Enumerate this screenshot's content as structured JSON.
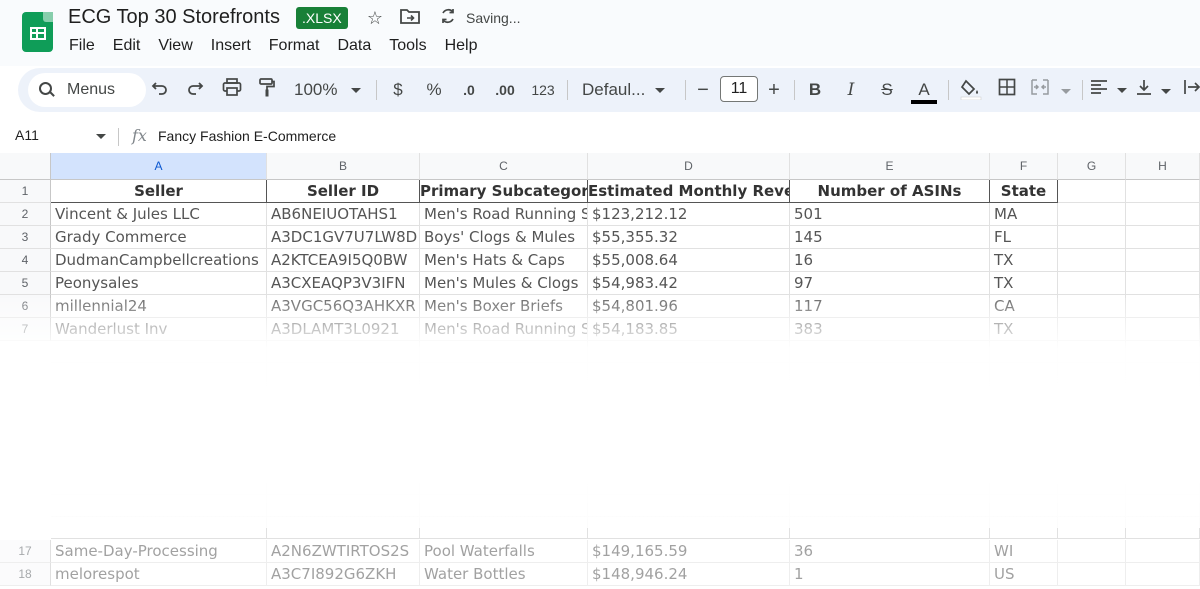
{
  "header": {
    "title": "ECG Top 30 Storefronts",
    "badge": ".XLSX",
    "status": "Saving...",
    "star_icon": "star-icon",
    "move_icon": "folder-move-icon",
    "sync_icon": "sync-icon"
  },
  "menubar": [
    "File",
    "Edit",
    "View",
    "Insert",
    "Format",
    "Data",
    "Tools",
    "Help"
  ],
  "toolbar": {
    "menus_label": "Menus",
    "zoom": "100%",
    "currency": "$",
    "percent": "%",
    "dec_decrease": ".0",
    "dec_increase": ".00",
    "number_format": "123",
    "font": "Defaul...",
    "font_size": "11",
    "minus": "−",
    "plus": "+",
    "bold": "B",
    "italic": "I",
    "strike": "S",
    "text_color": "A"
  },
  "formula": {
    "name_box": "A11",
    "fx": "fx",
    "value": "Fancy Fashion E-Commerce"
  },
  "columns": [
    "A",
    "B",
    "C",
    "D",
    "E",
    "F",
    "G",
    "H"
  ],
  "rows": [
    {
      "num": "1",
      "cells": [
        "Seller",
        "Seller ID",
        "Primary Subcategory",
        "Estimated Monthly Revenue",
        "Number of ASINs",
        "State"
      ]
    },
    {
      "num": "2",
      "cells": [
        "Vincent & Jules LLC",
        "AB6NEIUOTAHS1",
        "Men's Road Running Sho",
        "$123,212.12",
        "501",
        "MA"
      ]
    },
    {
      "num": "3",
      "cells": [
        "Grady Commerce",
        "A3DC1GV7U7LW8D",
        "Boys' Clogs & Mules",
        "$55,355.32",
        "145",
        "FL"
      ]
    },
    {
      "num": "4",
      "cells": [
        "DudmanCampbellcreations",
        "A2KTCEA9I5Q0BW",
        "Men's Hats & Caps",
        "$55,008.64",
        "16",
        "TX"
      ]
    },
    {
      "num": "5",
      "cells": [
        "Peonysales",
        "A3CXEAQP3V3IFN",
        "Men's Mules & Clogs",
        "$54,983.42",
        "97",
        "TX"
      ]
    },
    {
      "num": "6",
      "cells": [
        "millennial24",
        "A3VGC56Q3AHKXR",
        "Men's Boxer Briefs",
        "$54,801.96",
        "117",
        "CA"
      ]
    },
    {
      "num": "7",
      "cells": [
        "Wanderlust Inv",
        "A3DLAMT3L0921",
        "Men's Road Running Sho",
        "$54,183.85",
        "383",
        "TX"
      ]
    }
  ],
  "bottom_rows": [
    {
      "num": "17",
      "cells": [
        "Same-Day-Processing",
        "A2N6ZWTIRTOS2S",
        "Pool Waterfalls",
        "$149,165.59",
        "36",
        "WI"
      ]
    },
    {
      "num": "18",
      "cells": [
        "melorespot",
        "A3C7I892G6ZKH",
        "Water Bottles",
        "$148,946.24",
        "1",
        "US"
      ]
    }
  ]
}
